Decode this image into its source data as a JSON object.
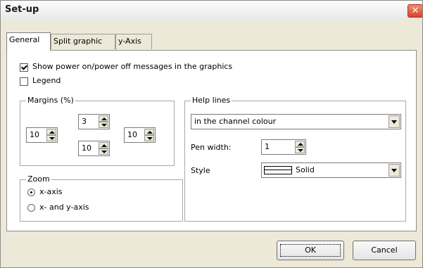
{
  "window": {
    "title": "Set-up",
    "close_glyph": "✕"
  },
  "tabs": [
    {
      "label": "General",
      "active": true
    },
    {
      "label": "Split graphic",
      "active": false
    },
    {
      "label": "y-Axis",
      "active": false
    }
  ],
  "general": {
    "show_power_msgs": {
      "label": "Show power on/power off messages in the graphics",
      "checked": true
    },
    "legend": {
      "label": "Legend",
      "checked": false
    },
    "margins": {
      "title": "Margins (%)",
      "top": "3",
      "left": "10",
      "right": "10",
      "bottom": "10"
    },
    "zoom": {
      "title": "Zoom",
      "options": [
        {
          "label": "x-axis",
          "selected": true
        },
        {
          "label": "x- and y-axis",
          "selected": false
        }
      ]
    },
    "help_lines": {
      "title": "Help lines",
      "colour_mode": "in the channel colour",
      "pen_width_label": "Pen width:",
      "pen_width": "1",
      "style_label": "Style",
      "style": "Solid"
    }
  },
  "buttons": {
    "ok": "OK",
    "cancel": "Cancel"
  },
  "icons": {
    "close": "close-icon",
    "check": "check-icon",
    "spin_up": "arrow-up-icon",
    "spin_down": "arrow-down-icon",
    "dropdown": "chevron-down-icon"
  }
}
